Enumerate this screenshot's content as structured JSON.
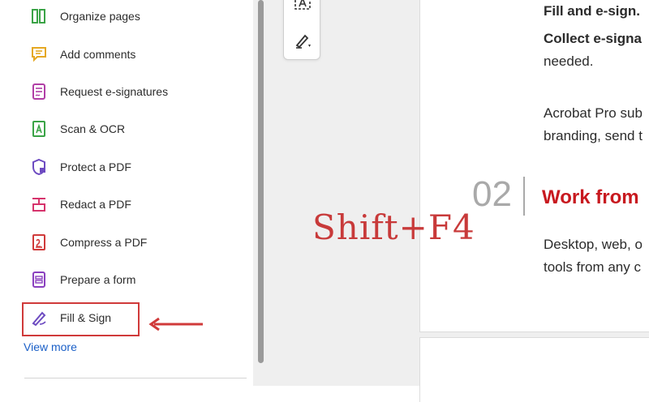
{
  "sidebar": {
    "items": [
      {
        "label": "Organize pages",
        "icon": "organize-pages-icon"
      },
      {
        "label": "Add comments",
        "icon": "add-comments-icon"
      },
      {
        "label": "Request e-signatures",
        "icon": "request-esignatures-icon"
      },
      {
        "label": "Scan & OCR",
        "icon": "scan-ocr-icon"
      },
      {
        "label": "Protect a PDF",
        "icon": "protect-pdf-icon"
      },
      {
        "label": "Redact a PDF",
        "icon": "redact-pdf-icon"
      },
      {
        "label": "Compress a PDF",
        "icon": "compress-pdf-icon"
      },
      {
        "label": "Prepare a form",
        "icon": "prepare-form-icon"
      },
      {
        "label": "Fill & Sign",
        "icon": "fill-sign-icon"
      }
    ],
    "view_more": "View more"
  },
  "annotation": {
    "shortcut": "Shift+F4",
    "highlight_color": "#d03a3a"
  },
  "document": {
    "line1": "Fill and e-sign.",
    "line2": "Collect e-signa",
    "line3": "needed.",
    "line4": "Acrobat Pro sub",
    "line5": "branding, send t",
    "section_number": "02",
    "section_title": "Work from",
    "line6": "Desktop, web, o",
    "line7": "tools from any c"
  },
  "colors": {
    "accent_red": "#c8191f",
    "link_blue": "#1a5fc7"
  }
}
